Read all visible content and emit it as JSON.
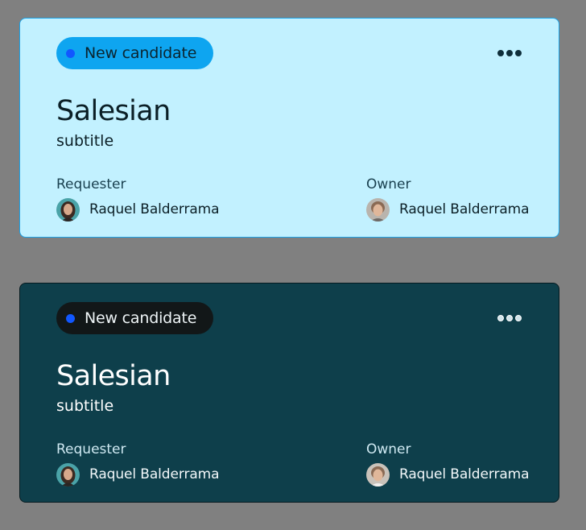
{
  "cards": [
    {
      "theme": "light",
      "status_label": "New candidate",
      "title": "Salesian",
      "subtitle": "subtitle",
      "requester_label": "Requester",
      "requester_name": "Raquel Balderrama",
      "owner_label": "Owner",
      "owner_name": "Raquel Balderrama"
    },
    {
      "theme": "dark",
      "status_label": "New candidate",
      "title": "Salesian",
      "subtitle": "subtitle",
      "requester_label": "Requester",
      "requester_name": "Raquel Balderrama",
      "owner_label": "Owner",
      "owner_name": "Raquel Balderrama"
    }
  ],
  "colors": {
    "page_background": "#808080",
    "light_card_bg": "#c2f1ff",
    "light_badge_bg": "#0ea5f0",
    "dark_card_bg": "#0e3f4b",
    "dark_badge_bg": "#121718",
    "status_dot": "#1157ff"
  },
  "icons": {
    "more": "more-horizontal-icon",
    "status": "status-dot-icon"
  }
}
